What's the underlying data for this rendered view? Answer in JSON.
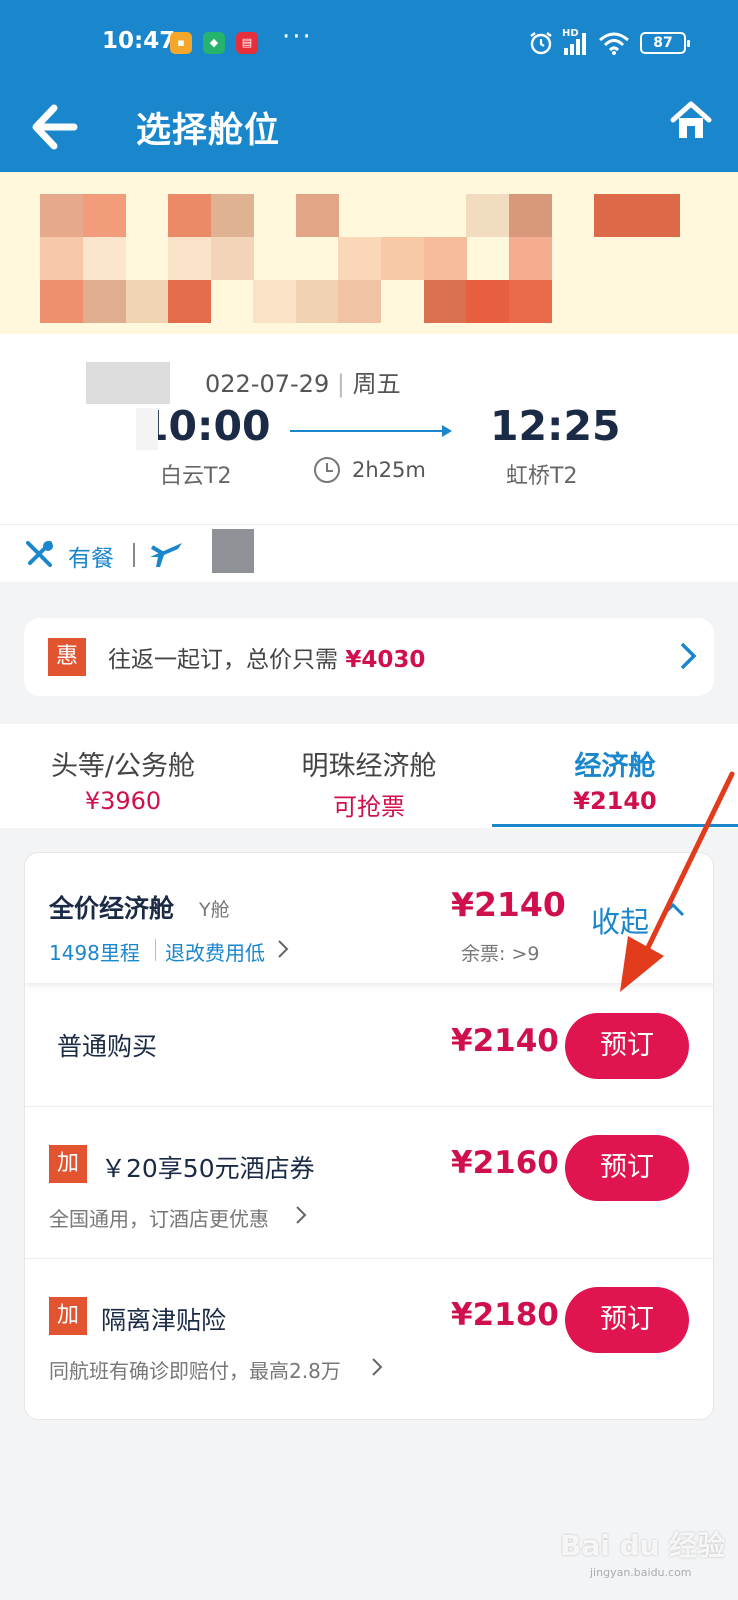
{
  "status_bar": {
    "time": "10:47",
    "dots": "···",
    "battery": "87",
    "network": "HD"
  },
  "header": {
    "title": "选择舱位",
    "back_icon": "arrow-left-icon",
    "home_icon": "home-icon",
    "bg_color": "#1a86cc"
  },
  "flight": {
    "date": "022-07-29",
    "weekday": "周五",
    "dep_time": "10:00",
    "arr_time": "12:25",
    "dep_airport": "白云T2",
    "arr_airport": "虹桥T2",
    "duration": "2h25m",
    "meal": "有餐"
  },
  "promo": {
    "tag": "惠",
    "text": "往返一起订，总价只需",
    "price": "¥4030"
  },
  "tabs": [
    {
      "label": "头等/公务舱",
      "price": "¥3960",
      "active": false
    },
    {
      "label": "明珠经济舱",
      "price": "可抢票",
      "active": false
    },
    {
      "label": "经济舱",
      "price": "¥2140",
      "active": true
    }
  ],
  "fare": {
    "name": "全价经济舱",
    "class": "Y舱",
    "price": "¥2140",
    "miles": "1498里程",
    "refund": "退改费用低",
    "remaining": "余票: >9",
    "collapse_label": "收起",
    "options": [
      {
        "tag": "",
        "title": "普通购买",
        "subtitle": "",
        "price": "¥2140",
        "button": "预订"
      },
      {
        "tag": "加",
        "title": "￥20享50元酒店券",
        "subtitle": "全国通用，订酒店更优惠",
        "price": "¥2160",
        "button": "预订"
      },
      {
        "tag": "加",
        "title": "隔离津贴险",
        "subtitle": "同航班有确诊即赔付，最高2.8万",
        "price": "¥2180",
        "button": "预订"
      }
    ]
  },
  "colors": {
    "accent": "#1a86cc",
    "price": "#d0104c",
    "button": "#e0144f",
    "tag": "#e2532f"
  },
  "watermark": {
    "logo": "Bai du 经验",
    "url": "jingyan.baidu.com"
  }
}
